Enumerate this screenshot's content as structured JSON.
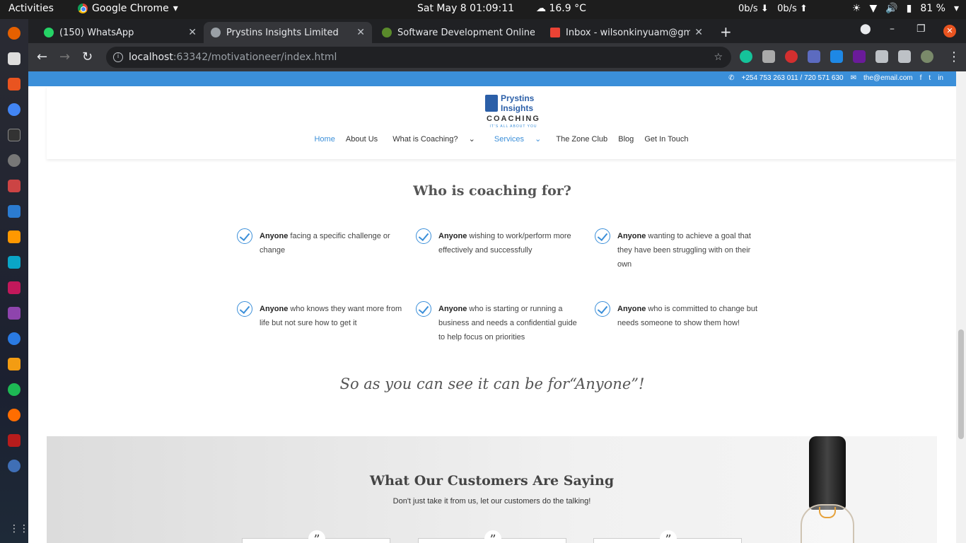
{
  "desktop": {
    "activities": "Activities",
    "app_name": "Google Chrome",
    "clock": "Sat May 8  01:09:11",
    "weather": "16.9 °C",
    "net_down": "0b/s",
    "net_up": "0b/s",
    "battery": "81 %"
  },
  "browser": {
    "tabs": [
      {
        "title": "(150) WhatsApp",
        "favicon_color": "#25d366"
      },
      {
        "title": "Prystins Insights Limited",
        "favicon_color": "#9aa0a6"
      },
      {
        "title": "Software Development Online",
        "favicon_color": "#5a8a2b"
      },
      {
        "title": "Inbox - wilsonkinyuam@gmail.co",
        "favicon_color": "#ea4335"
      }
    ],
    "url_host": "localhost",
    "url_rest": ":63342/motivationeer/index.html"
  },
  "site": {
    "contact_phone": "+254 753 263 011 / 720 571 630",
    "contact_email": "the@email.com",
    "logo_line1": "Prystins",
    "logo_line2": "Insights",
    "logo_coaching": "COACHING",
    "logo_tagline": "IT'S ALL ABOUT YOU",
    "menu": [
      "Home",
      "About Us",
      "What is Coaching?",
      "Services",
      "The Zone Club",
      "Blog",
      "Get In Touch"
    ],
    "who_heading": "Who is coaching for?",
    "items": [
      {
        "bold": "Anyone",
        "text": " facing a specific challenge or change"
      },
      {
        "bold": "Anyone",
        "text": " wishing to work/perform more effectively and successfully"
      },
      {
        "bold": "Anyone",
        "text": " wanting to achieve a goal that they have been struggling with on their own"
      },
      {
        "bold": "Anyone",
        "text": " who knows they want more from life but not sure how to get it"
      },
      {
        "bold": "Anyone",
        "text": " who is starting or running a business and needs a confidential guide to help focus on priorities"
      },
      {
        "bold": "Anyone",
        "text": " who is committed to change but needs someone to show them how!"
      }
    ],
    "anyone_line": "So as you can see it can be for“Anyone”!",
    "testimonials_heading": "What Our Customers Are Saying",
    "testimonials_sub": "Don't just take it from us, let our customers do the talking!",
    "quote_glyph": "”"
  }
}
